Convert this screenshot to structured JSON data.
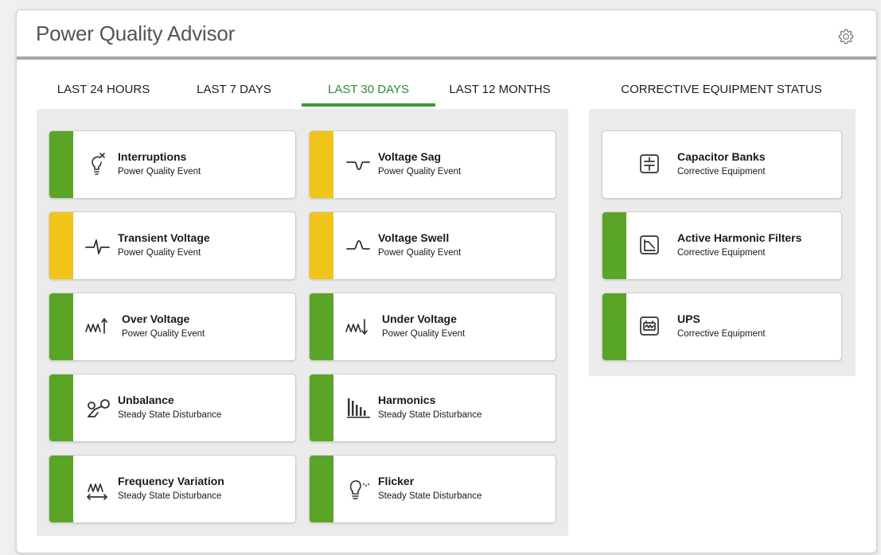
{
  "app": {
    "title": "Power Quality Advisor"
  },
  "tabs": [
    {
      "label": "LAST 24 HOURS",
      "active": false
    },
    {
      "label": "LAST 7 DAYS",
      "active": false
    },
    {
      "label": "LAST 30 DAYS",
      "active": true
    },
    {
      "label": "LAST 12 MONTHS",
      "active": false
    }
  ],
  "equipment_tab": {
    "label": "CORRECTIVE EQUIPMENT STATUS"
  },
  "colors": {
    "green": "#5aa427",
    "yellow": "#f0c419",
    "active_tab": "#2e8b37"
  },
  "events": [
    {
      "title": "Interruptions",
      "subtitle": "Power Quality Event",
      "status": "green",
      "icon": "bulb-x-icon"
    },
    {
      "title": "Voltage Sag",
      "subtitle": "Power Quality Event",
      "status": "yellow",
      "icon": "sag-wave-icon"
    },
    {
      "title": "Transient Voltage",
      "subtitle": "Power Quality Event",
      "status": "yellow",
      "icon": "transient-wave-icon"
    },
    {
      "title": "Voltage Swell",
      "subtitle": "Power Quality Event",
      "status": "yellow",
      "icon": "swell-wave-icon"
    },
    {
      "title": "Over Voltage",
      "subtitle": "Power Quality Event",
      "status": "green",
      "icon": "over-voltage-icon"
    },
    {
      "title": "Under Voltage",
      "subtitle": "Power Quality Event",
      "status": "green",
      "icon": "under-voltage-icon"
    },
    {
      "title": "Unbalance",
      "subtitle": "Steady State Disturbance",
      "status": "green",
      "icon": "unbalance-icon"
    },
    {
      "title": "Harmonics",
      "subtitle": "Steady State Disturbance",
      "status": "green",
      "icon": "harmonics-bars-icon"
    },
    {
      "title": "Frequency Variation",
      "subtitle": "Steady State Disturbance",
      "status": "green",
      "icon": "frequency-wave-icon"
    },
    {
      "title": "Flicker",
      "subtitle": "Steady State Disturbance",
      "status": "green",
      "icon": "flicker-bulb-icon"
    }
  ],
  "equipment": [
    {
      "title": "Capacitor Banks",
      "subtitle": "Corrective Equipment",
      "status": "none",
      "icon": "capacitor-icon"
    },
    {
      "title": "Active Harmonic Filters",
      "subtitle": "Corrective Equipment",
      "status": "green",
      "icon": "harmonic-filter-icon"
    },
    {
      "title": "UPS",
      "subtitle": "Corrective Equipment",
      "status": "green",
      "icon": "ups-battery-icon"
    }
  ]
}
